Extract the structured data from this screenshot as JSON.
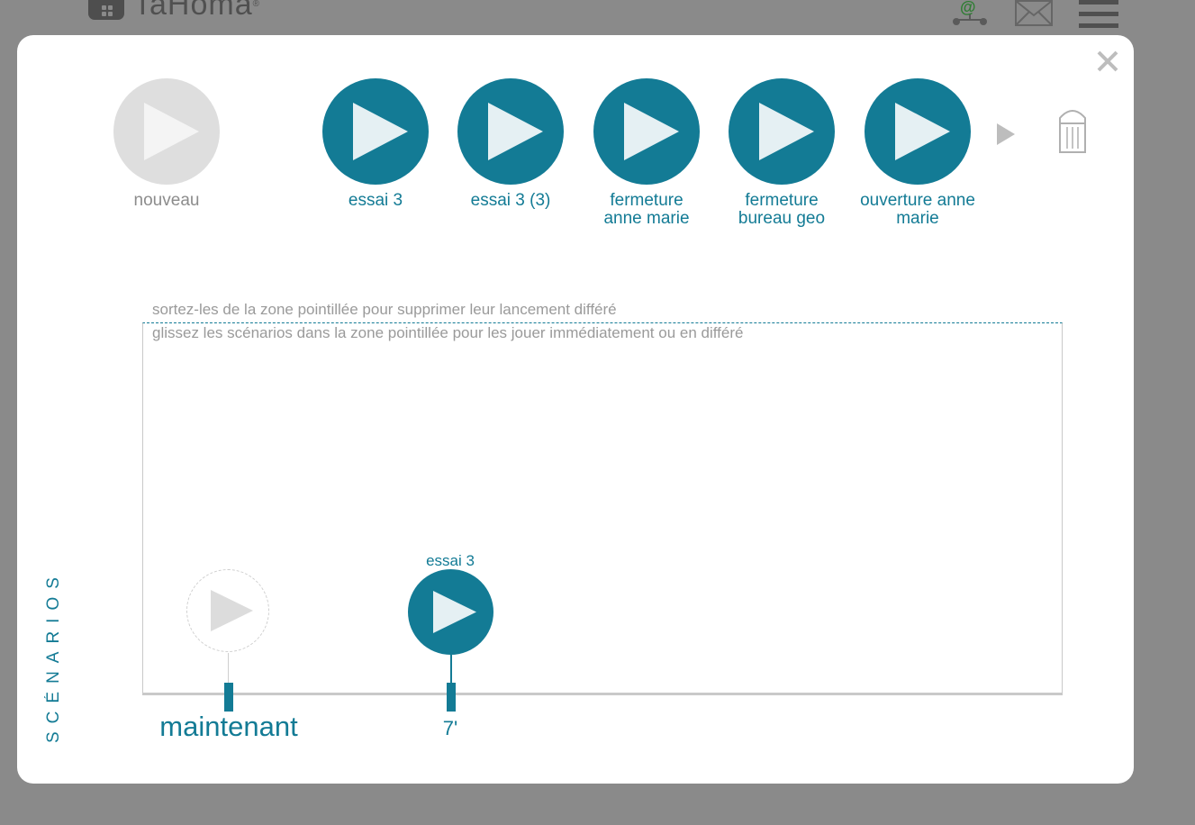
{
  "app": {
    "logo_text": "TaHoma",
    "registered_mark": "®",
    "icons": [
      "network-at-icon",
      "mail-icon",
      "hamburger-menu-icon"
    ]
  },
  "modal": {
    "close_icon": "close-icon",
    "new_scenario": {
      "label": "nouveau",
      "icon": "play-icon"
    },
    "scenarios": [
      {
        "label": "essai 3"
      },
      {
        "label": "essai 3 (3)"
      },
      {
        "label": "fermeture anne marie"
      },
      {
        "label": "fermeture bureau geo"
      },
      {
        "label": "ouverture anne marie"
      }
    ],
    "next_icon": "play-arrow-icon",
    "trash_icon": "trash-icon",
    "hint_remove": "sortez-les de la zone pointillée pour supprimer leur lancement différé",
    "hint_drop": "glissez les scénarios dans la zone pointillée pour les jouer immédiatement ou en différé",
    "timeline": {
      "now_label": "maintenant",
      "scheduled": [
        {
          "label": "essai 3",
          "time": "7'"
        }
      ]
    },
    "side_title": "SCÉNARIOS"
  },
  "colors": {
    "accent": "#137b95",
    "overlay": "#8a8a8a",
    "inactive": "#dedede",
    "hint_text": "#9a9a9a"
  }
}
